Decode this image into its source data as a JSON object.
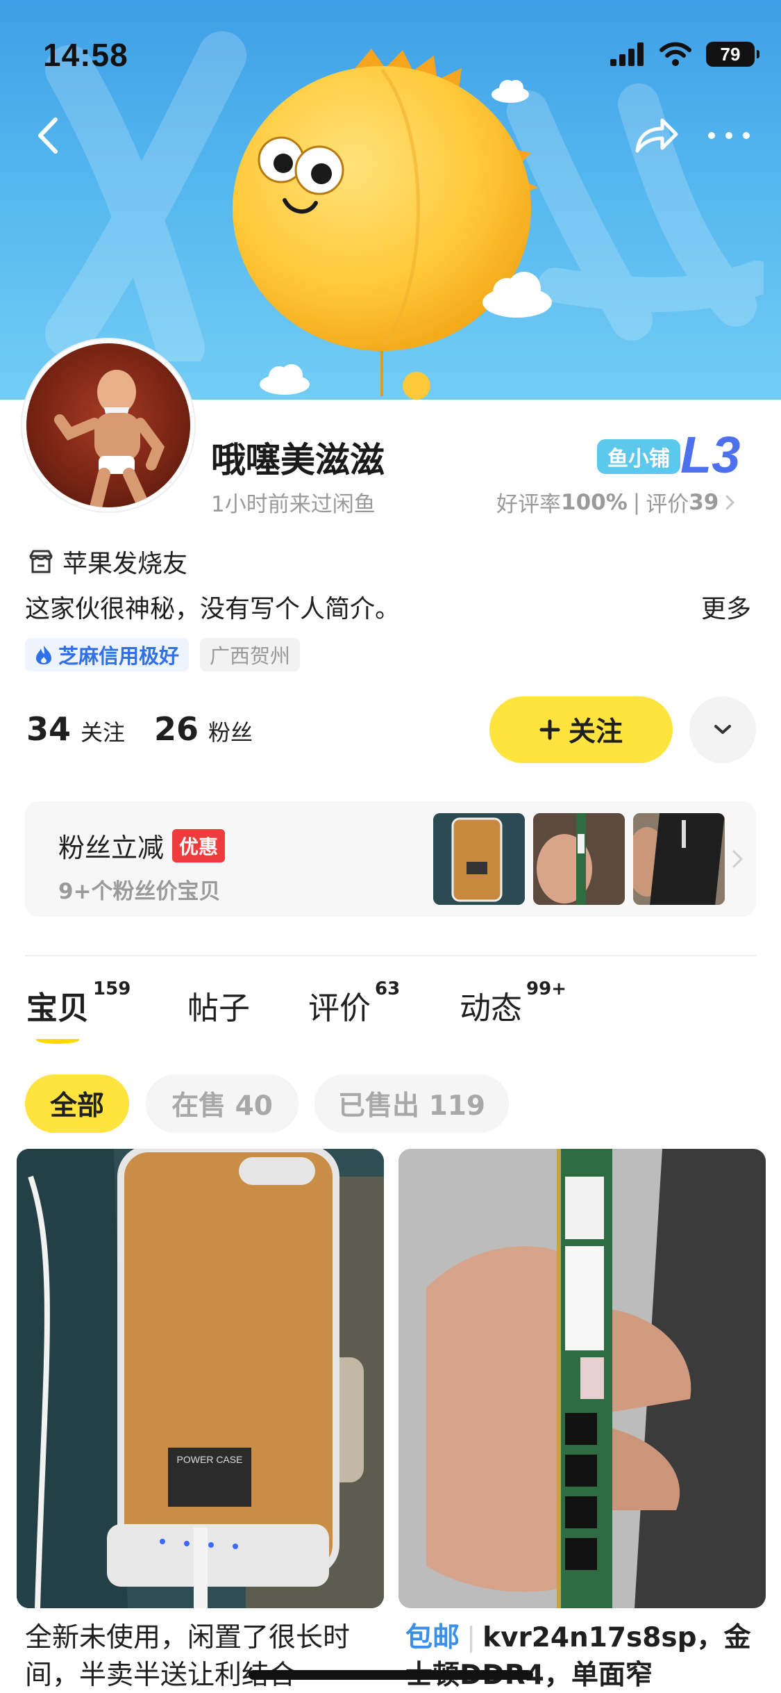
{
  "status_bar": {
    "time": "14:58",
    "battery": "79"
  },
  "profile": {
    "nickname": "哦噻美滋滋",
    "last_seen": "1小时前来过闲鱼",
    "shop_badge": "鱼小铺",
    "shop_level": "L3",
    "rating_label": "好评率",
    "rating_value": "100%",
    "rating_sep": "|",
    "review_label": "评价",
    "review_count": "39",
    "shop_name": "苹果发烧友",
    "bio": "这家伙很神秘，没有写个人简介。",
    "more_label": "更多",
    "credit_tag": "芝麻信用极好",
    "location_tag": "广西贺州",
    "following_count": "34",
    "following_label": "关注",
    "fans_count": "26",
    "fans_label": "粉丝",
    "follow_button": "关注"
  },
  "fans_discount": {
    "title": "粉丝立减",
    "promo_tag": "优惠",
    "subtitle": "9+个粉丝价宝贝"
  },
  "tabs": [
    {
      "label": "宝贝",
      "count": "159"
    },
    {
      "label": "帖子",
      "count": ""
    },
    {
      "label": "评价",
      "count": "63"
    },
    {
      "label": "动态",
      "count": "99+"
    }
  ],
  "filters": [
    {
      "label": "全部"
    },
    {
      "label": "在售 40"
    },
    {
      "label": "已售出 119"
    }
  ],
  "items": [
    {
      "title": "全新未使用，闲置了很长时间，半卖半送让利结合",
      "case_label": "POWER CASE"
    },
    {
      "tag": "包邮",
      "title": "kvr24n17s8sp，金士顿DDR4，单面窄"
    }
  ],
  "colors": {
    "accent_yellow": "#ffe33f",
    "banner_blue": "#55b7ef",
    "level_blue": "#4c70ee",
    "credit_blue": "#2f6fe8",
    "promo_red": "#ee3b3b"
  },
  "icons": {
    "back": "chevron-left-icon",
    "share": "share-arrow-icon",
    "more": "more-dots-icon",
    "shop": "shop-icon",
    "credit": "flame-icon",
    "dropdown": "chevron-down-icon"
  }
}
